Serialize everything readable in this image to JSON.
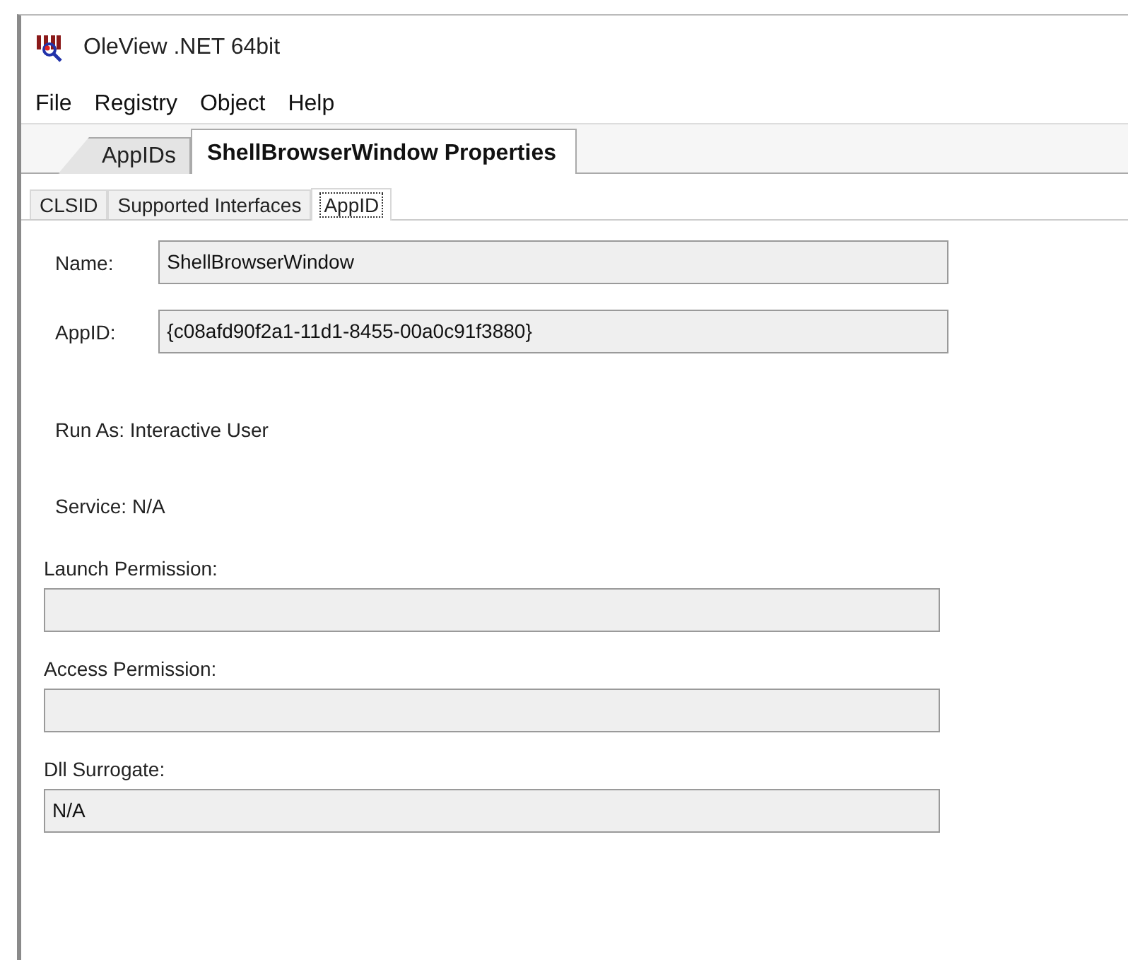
{
  "window": {
    "title": "OleView .NET 64bit"
  },
  "menu": [
    "File",
    "Registry",
    "Object",
    "Help"
  ],
  "tabs": [
    {
      "label": "AppIDs",
      "selected": false
    },
    {
      "label": "ShellBrowserWindow Properties",
      "selected": true
    }
  ],
  "subtabs": [
    {
      "label": "CLSID",
      "selected": false
    },
    {
      "label": "Supported Interfaces",
      "selected": false
    },
    {
      "label": "AppID",
      "selected": true
    }
  ],
  "fields": [
    {
      "kind": "inline",
      "label": "Name:",
      "value": "ShellBrowserWindow"
    },
    {
      "kind": "inline",
      "label": "AppID:",
      "value": "{c08afd90f2a1-11d1-8455-00a0c91f3880}"
    },
    {
      "kind": "text",
      "label": "Run As: Interactive User"
    },
    {
      "kind": "text",
      "label": "Service: N/A"
    },
    {
      "kind": "stacked",
      "label": "Launch Permission:"
    },
    {
      "kind": "stacked",
      "label": "Access Permission:"
    },
    {
      "kind": "stacked",
      "label": "Dll Surrogate:",
      "value": "N/A"
    }
  ]
}
